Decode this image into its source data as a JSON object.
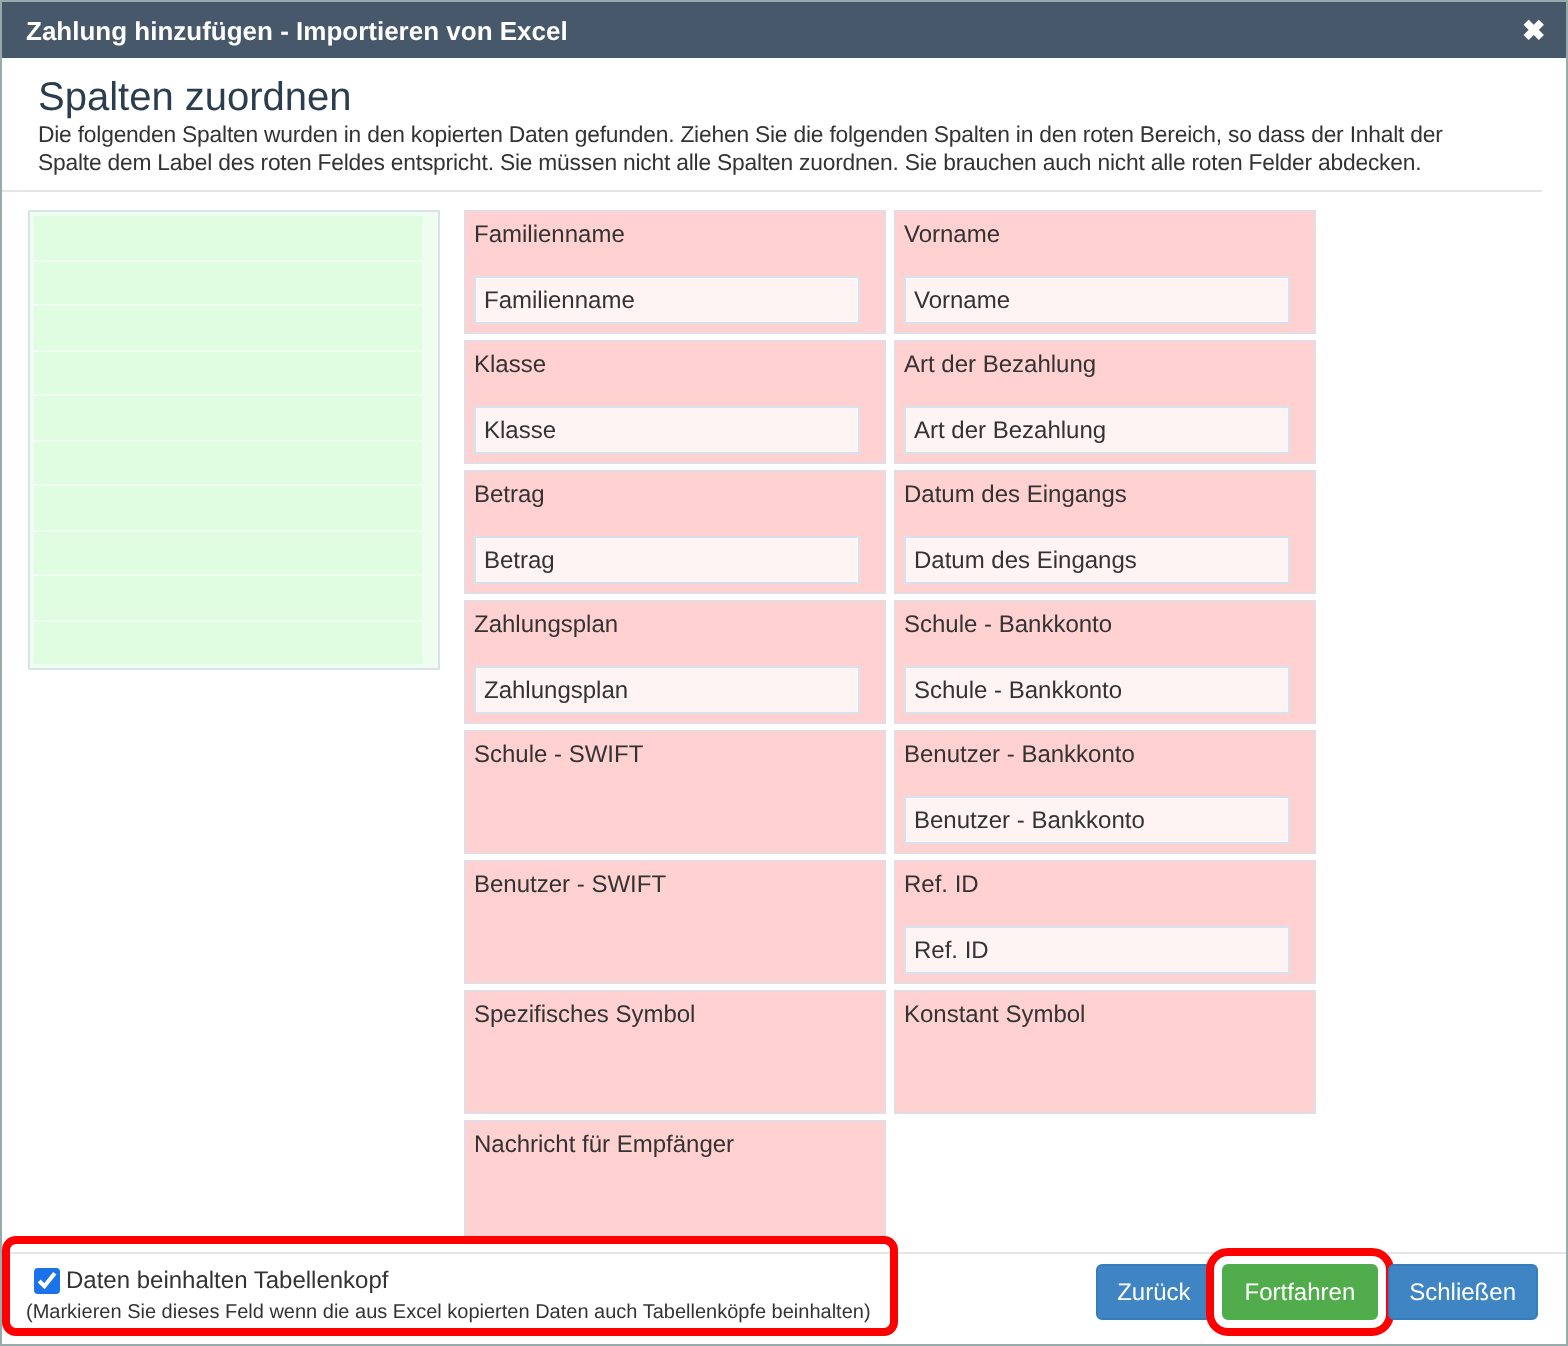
{
  "window": {
    "title": "Zahlung hinzufügen - Importieren von Excel",
    "close": "✖"
  },
  "heading": "Spalten zuordnen",
  "description": "Die folgenden Spalten wurden in den kopierten Daten gefunden. Ziehen Sie die folgenden Spalten in den roten Bereich, so dass der Inhalt der Spalte dem Label des roten Feldes entspricht. Sie müssen nicht alle Spalten zuordnen. Sie brauchen auch nicht alle roten Felder abdecken.",
  "fields": [
    {
      "label": "Familienname",
      "value": "Familienname"
    },
    {
      "label": "Vorname",
      "value": "Vorname"
    },
    {
      "label": "Klasse",
      "value": "Klasse"
    },
    {
      "label": "Art der Bezahlung",
      "value": "Art der Bezahlung"
    },
    {
      "label": "Betrag",
      "value": "Betrag"
    },
    {
      "label": "Datum des Eingangs",
      "value": "Datum des Eingangs"
    },
    {
      "label": "Zahlungsplan",
      "value": "Zahlungsplan"
    },
    {
      "label": "Schule - Bankkonto",
      "value": "Schule - Bankkonto"
    },
    {
      "label": "Schule - SWIFT"
    },
    {
      "label": "Benutzer - Bankkonto",
      "value": "Benutzer - Bankkonto"
    },
    {
      "label": "Benutzer - SWIFT"
    },
    {
      "label": "Ref. ID",
      "value": "Ref. ID"
    },
    {
      "label": "Spezifisches Symbol"
    },
    {
      "label": "Konstant Symbol"
    },
    {
      "label": "Nachricht für Empfänger"
    }
  ],
  "header_option": {
    "label": "Daten beinhalten Tabellenkopf",
    "checked": true,
    "hint": "(Markieren Sie dieses Feld wenn die aus Excel kopierten Daten auch Tabellenköpfe beinhalten)",
    "highlighted": true
  },
  "buttons": [
    {
      "label": "Zurück",
      "kind": "primary",
      "highlighted": false
    },
    {
      "label": "Fortfahren",
      "kind": "success",
      "highlighted": true
    },
    {
      "label": "Schließen",
      "kind": "primary",
      "highlighted": false
    }
  ]
}
